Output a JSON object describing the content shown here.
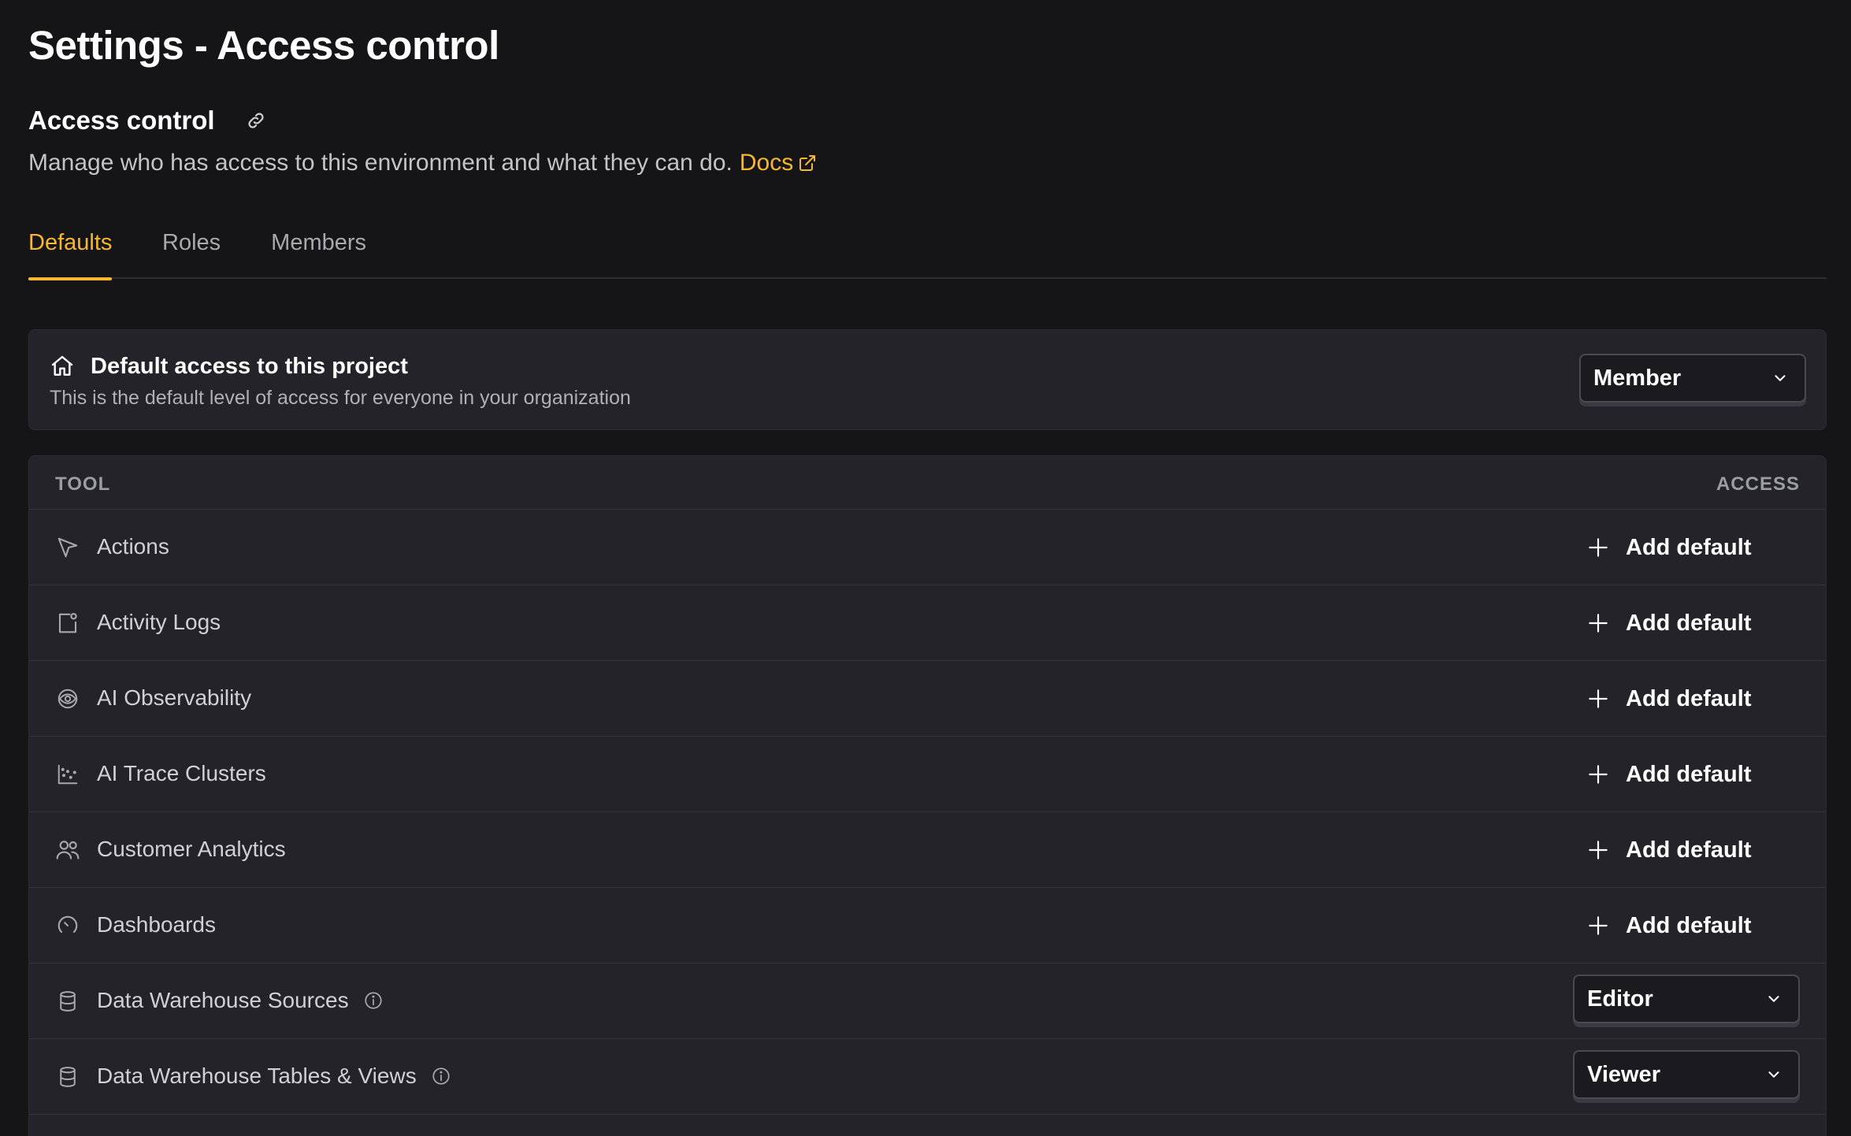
{
  "page": {
    "title": "Settings - Access control"
  },
  "section": {
    "title": "Access control",
    "description": "Manage who has access to this environment and what they can do.",
    "docs_label": "Docs"
  },
  "tabs": [
    {
      "label": "Defaults",
      "active": true
    },
    {
      "label": "Roles",
      "active": false
    },
    {
      "label": "Members",
      "active": false
    }
  ],
  "default_access": {
    "title": "Default access to this project",
    "subtitle": "This is the default level of access for everyone in your organization",
    "value": "Member"
  },
  "table": {
    "headers": {
      "tool": "TOOL",
      "access": "ACCESS"
    },
    "rows": [
      {
        "name": "Actions",
        "icon": "cursor-icon",
        "access": "Add default"
      },
      {
        "name": "Activity Logs",
        "icon": "activity-log-icon",
        "access": "Add default"
      },
      {
        "name": "AI Observability",
        "icon": "observability-icon",
        "access": "Add default"
      },
      {
        "name": "AI Trace Clusters",
        "icon": "scatter-plot-icon",
        "access": "Add default"
      },
      {
        "name": "Customer Analytics",
        "icon": "users-icon",
        "access": "Add default"
      },
      {
        "name": "Dashboards",
        "icon": "gauge-icon",
        "access": "Add default"
      },
      {
        "name": "Data Warehouse Sources",
        "icon": "database-icon",
        "access": "Editor",
        "has_info": true
      },
      {
        "name": "Data Warehouse Tables & Views",
        "icon": "database-icon",
        "access": "Viewer",
        "has_info": true
      }
    ]
  },
  "colors": {
    "accent": "#f7b731",
    "background": "#151518",
    "card": "#232329"
  }
}
